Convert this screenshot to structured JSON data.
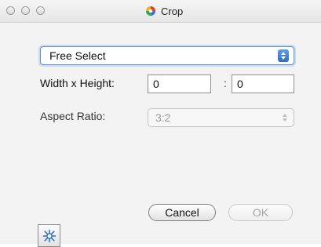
{
  "window": {
    "title": "Crop",
    "icon": "color-wheel-icon"
  },
  "selection_mode": {
    "selected": "Free Select"
  },
  "size_row": {
    "label": "Width x Height:",
    "width_value": "0",
    "separator": ":",
    "height_value": "0"
  },
  "aspect_row": {
    "label": "Aspect Ratio:",
    "selected": "3:2",
    "disabled": true
  },
  "buttons": {
    "tool_icon": "crosshair-sparkle-icon",
    "cancel_label": "Cancel",
    "ok_label": "OK"
  },
  "colors": {
    "accent_blue": "#4a86d8",
    "disabled_text": "#a5a5a5"
  }
}
